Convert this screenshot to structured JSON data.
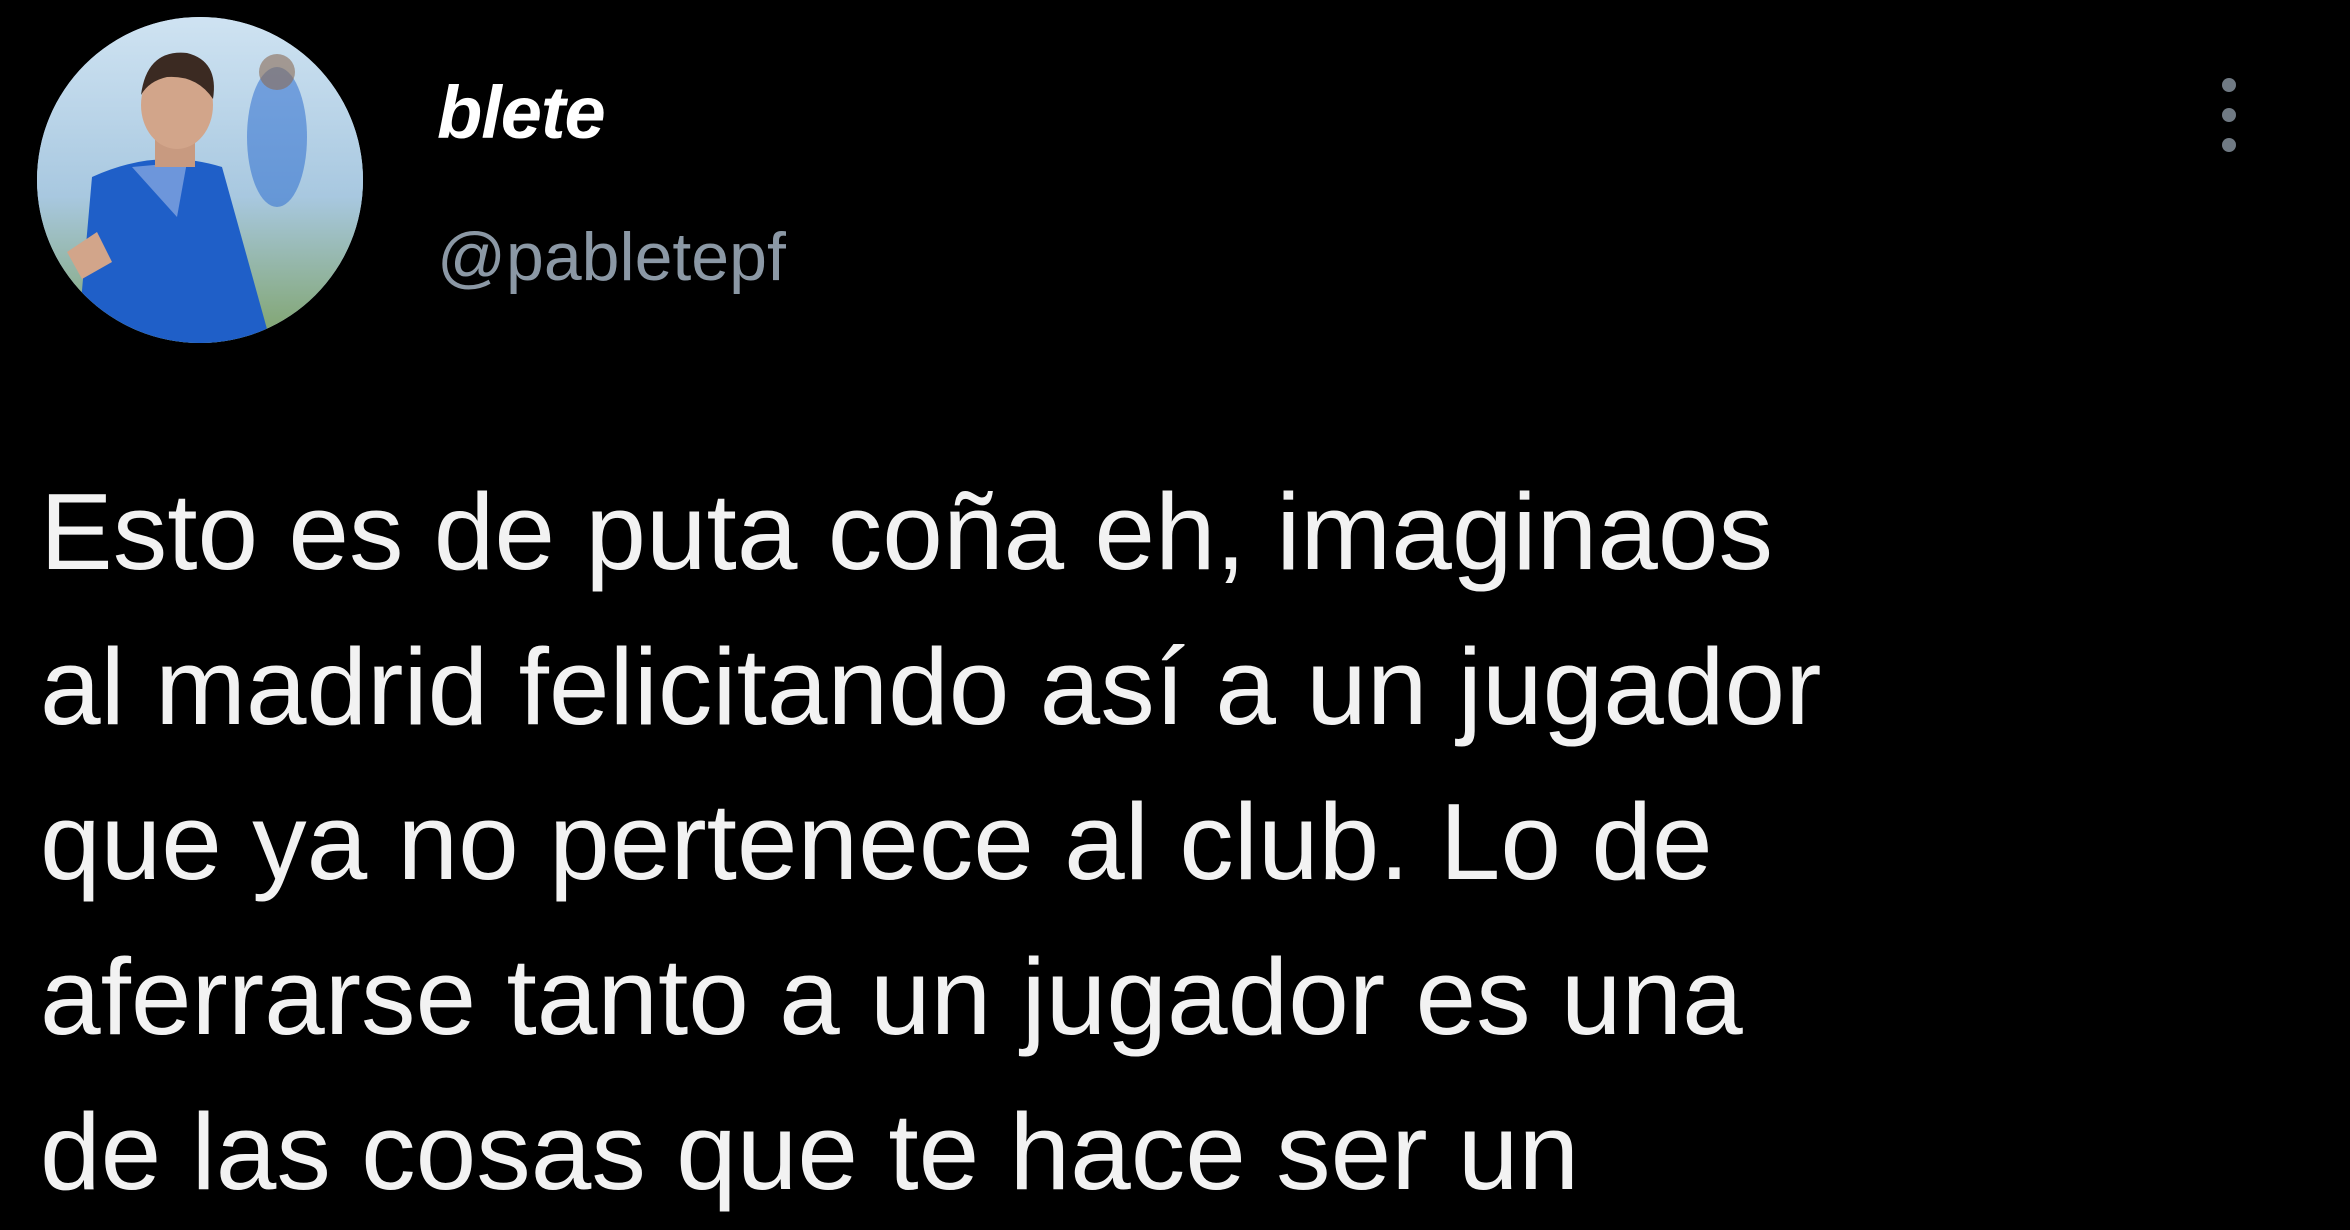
{
  "tweet": {
    "author": {
      "display_name": "blete",
      "handle": "@pabletepf",
      "avatar_icon": "profile-photo-football-player"
    },
    "more_icon": "vertical-ellipsis-icon",
    "text": "Esto es de puta coña eh, imaginaos\nal madrid felicitando así a un jugador\nque ya no pertenece al club. Lo de\naferrarse tanto a un jugador es una\nde las cosas que te hace ser un"
  },
  "colors": {
    "background": "#000000",
    "text": "#f2f2f2",
    "secondary_text": "#8b98a5",
    "more_icon": "#707a84"
  }
}
